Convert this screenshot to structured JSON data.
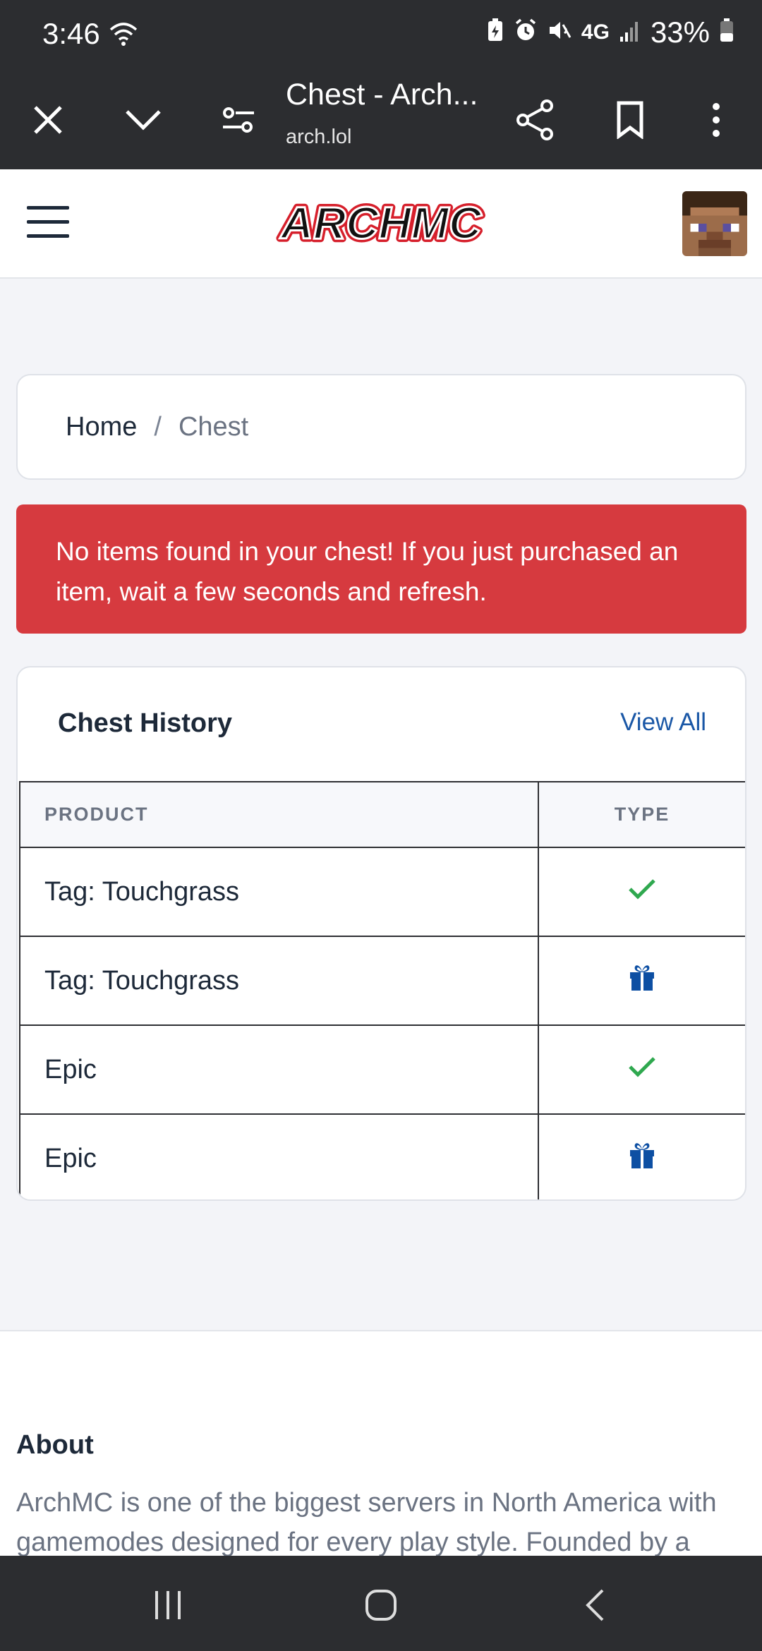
{
  "status_bar": {
    "time": "3:46",
    "network": "4G",
    "battery": "33%"
  },
  "browser": {
    "title": "Chest - Arch...",
    "url": "arch.lol"
  },
  "site": {
    "logo_text": "ARCHMC"
  },
  "breadcrumb": {
    "home": "Home",
    "separator": "/",
    "current": "Chest"
  },
  "alert": {
    "message": "No items found in your chest! If you just purchased an item, wait a few seconds and refresh."
  },
  "chest_history": {
    "title": "Chest History",
    "view_all": "View All",
    "columns": [
      "PRODUCT",
      "TYPE"
    ],
    "rows": [
      {
        "product": "Tag: Touchgrass",
        "type_icon": "check-icon"
      },
      {
        "product": "Tag: Touchgrass",
        "type_icon": "gift-icon"
      },
      {
        "product": "Epic",
        "type_icon": "check-icon"
      },
      {
        "product": "Epic",
        "type_icon": "gift-icon"
      }
    ]
  },
  "about": {
    "title": "About",
    "text": "ArchMC is one of the biggest servers in North America with gamemodes designed for every play style. Founded by a"
  },
  "colors": {
    "alert_bg": "#d63a3f",
    "link": "#1a57a6",
    "check": "#2fa84f",
    "gift": "#0d4fa3",
    "system_bar": "#2c2d30"
  }
}
